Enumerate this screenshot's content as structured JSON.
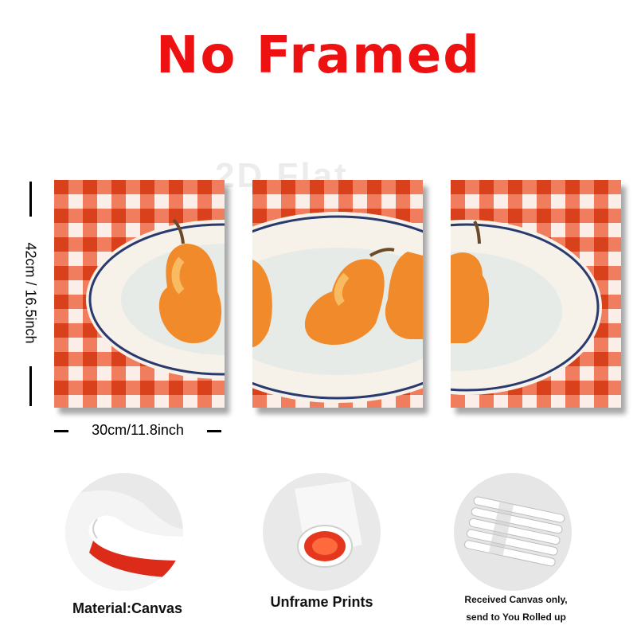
{
  "title": "No Framed",
  "watermark": "2D Flat",
  "dimensions": {
    "height": "42cm / 16.5inch",
    "width": "30cm/11.8inch"
  },
  "features": [
    {
      "caption": "Material:Canvas",
      "icon": "canvas-roll-corner"
    },
    {
      "caption": "Unframe  Prints",
      "icon": "rolled-canvas-tube"
    },
    {
      "caption_line1": "Received Canvas only,",
      "caption_line2": "send to You Rolled up",
      "icon": "packaged-rolls"
    }
  ],
  "colors": {
    "title": "#ee1111",
    "gingham": "#e8502c",
    "pear": "#f08a2a",
    "plate": "#eef0ec",
    "plate_rim": "#2a3a6e"
  }
}
